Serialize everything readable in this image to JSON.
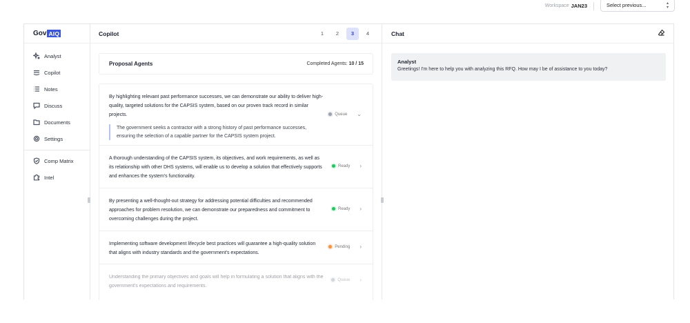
{
  "topbar": {
    "workspace_label": "Workspace",
    "workspace_value": "JAN23",
    "select_placeholder": "Select previous...",
    "select_icon": "up-down-chevron-icon"
  },
  "logo": {
    "text_prefix": "Gov",
    "text_box": "AIQ"
  },
  "sidebar": {
    "items": [
      {
        "label": "Analyst",
        "icon": "sparkle-icon"
      },
      {
        "label": "Copilot",
        "icon": "layers-icon"
      },
      {
        "label": "Notes",
        "icon": "list-icon"
      },
      {
        "label": "Discuss",
        "icon": "chat-bubble-icon"
      },
      {
        "label": "Documents",
        "icon": "folder-icon"
      },
      {
        "label": "Settings",
        "icon": "gear-icon"
      }
    ],
    "secondary_items": [
      {
        "label": "Comp Matrix",
        "icon": "shield-check-icon"
      },
      {
        "label": "Intel",
        "icon": "puzzle-icon"
      }
    ]
  },
  "copilot": {
    "title": "Copilot",
    "pages": [
      "1",
      "2",
      "3",
      "4"
    ],
    "active_page": "3",
    "agents_title": "Proposal Agents",
    "completed_label": "Completed Agents:",
    "completed_value": "10 / 15",
    "rows": [
      {
        "text": "By highlighting relevant past performance successes, we can demonstrate our ability to deliver high-quality, targeted solutions for the CAPSIS system, based on our proven track record in similar projects.",
        "quote": "The government seeks a contractor with a strong history of past performance successes, ensuring the selection of a capable partner for the CAPSIS system project.",
        "status": "Queue",
        "chevron": "chevron-down-icon"
      },
      {
        "text": "A thorough understanding of the CAPSIS system, its objectives, and work requirements, as well as its relationship with other DHS systems, will enable us to develop a solution that effectively supports and enhances the system's functionality.",
        "status": "Ready",
        "chevron": "chevron-right-icon"
      },
      {
        "text": "By presenting a well-thought-out strategy for addressing potential difficulties and recommended approaches for problem resolution, we can demonstrate our preparedness and commitment to overcoming challenges during the project.",
        "status": "Ready",
        "chevron": "chevron-right-icon"
      },
      {
        "text": "Implementing software development lifecycle best practices will guarantee a high-quality solution that aligns with industry standards and the government's expectations.",
        "status": "Pending",
        "chevron": "chevron-right-icon"
      },
      {
        "text": "Understanding the primary objectives and goals will help in formulating a solution that aligns with the government's expectations and requirements.",
        "status": "Queue",
        "chevron": "chevron-right-icon"
      }
    ]
  },
  "chat": {
    "title": "Chat",
    "clear_icon": "eraser-icon",
    "messages": [
      {
        "author": "Analyst",
        "text": "Greetings! I'm here to help you with analyzing this RFQ. How may I be of assistance to you today?"
      }
    ]
  },
  "colors": {
    "accent": "#3a55d6",
    "active_page_bg": "#dde1fb",
    "ready": "#22c55e",
    "pending": "#fb923c",
    "queue": "#9ca3af"
  }
}
